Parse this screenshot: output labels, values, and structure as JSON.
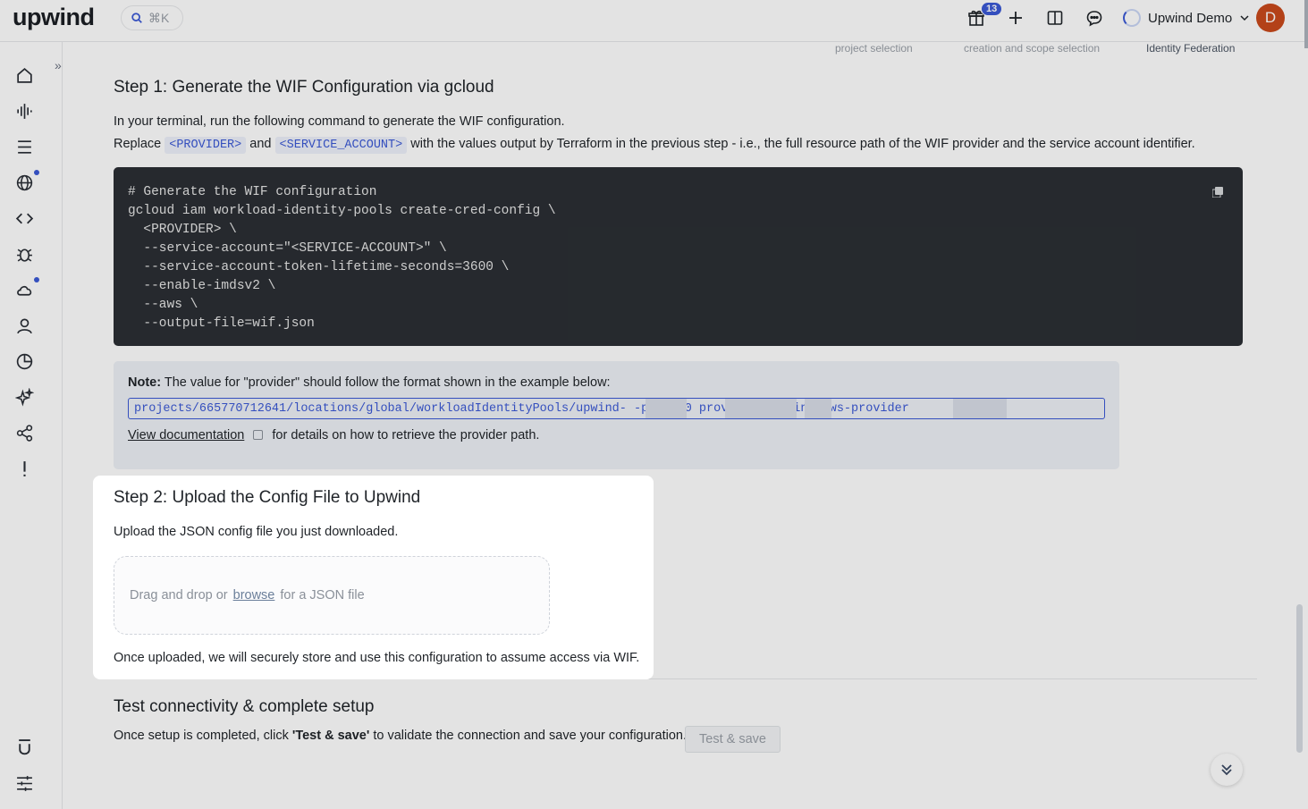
{
  "app": {
    "logo": "upwind"
  },
  "header": {
    "search_shortcut": "⌘K",
    "gift_badge": "13",
    "account_name": "Upwind Demo",
    "avatar_initial": "D"
  },
  "stepper": {
    "labels": [
      "project selection",
      "creation and scope selection",
      "Identity Federation"
    ]
  },
  "step1": {
    "title": "Step 1: Generate the WIF Configuration via gcloud",
    "line1": "In your terminal, run the following command to generate the WIF configuration.",
    "line2_prefix": "Replace",
    "provider_token": "<PROVIDER>",
    "and_word": "and",
    "service_account_token": "<SERVICE_ACCOUNT>",
    "line2_suffix": "with the values output by Terraform in the previous step - i.e., the full resource path of the WIF provider and the service account identifier.",
    "code": "# Generate the WIF configuration\ngcloud iam workload-identity-pools create-cred-config \\\n  <PROVIDER> \\\n  --service-account=\"<SERVICE-ACCOUNT>\" \\\n  --service-account-token-lifetime-seconds=3600 \\\n  --enable-imdsv2 \\\n  --aws \\\n  --output-file=wif.json"
  },
  "note": {
    "label": "Note:",
    "text": "The value for \"provider\" should follow the format shown in the example below:",
    "example_path": "projects/665770712641/locations/global/workloadIdentityPools/upwind-      -pool-         0    providers/upwinc       aws-provider",
    "doc_link": "View documentation",
    "doc_suffix": "for details on how to retrieve the provider path."
  },
  "step2": {
    "title": "Step 2: Upload the Config File to Upwind",
    "description": "Upload the JSON config file you just downloaded.",
    "dropzone_prefix": "Drag and drop or",
    "dropzone_browse": "browse",
    "dropzone_suffix": "for a JSON file",
    "footer": "Once uploaded, we will securely store and use this configuration to assume access via WIF."
  },
  "test": {
    "title": "Test connectivity & complete setup",
    "desc_prefix": "Once setup is completed, click ",
    "desc_bold": "'Test & save'",
    "desc_suffix": " to validate the connection and save your configuration.",
    "button": "Test & save"
  },
  "colors": {
    "accent": "#3b59d6",
    "avatar": "#c94a1c",
    "code_bg": "#2b2f34"
  }
}
